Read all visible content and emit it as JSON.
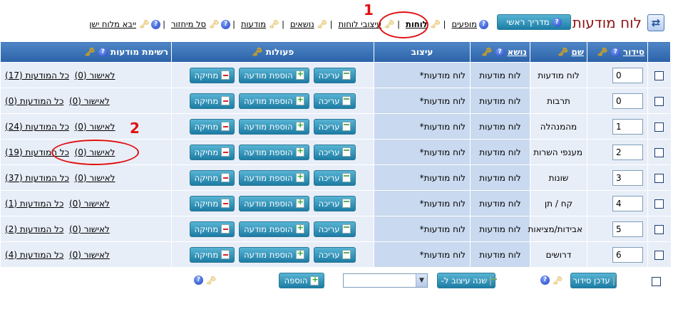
{
  "title": "לוח מודעות",
  "guide_button": "מדריך ראשי",
  "nav": {
    "items": [
      "מופעים",
      "לוחות",
      "עיצובי לוחות",
      "נושאים",
      "מודעות",
      "סל מיחזור",
      "ייבא מלוח ישן"
    ],
    "active": "לוחות"
  },
  "table": {
    "headers": {
      "order": "סידור",
      "name": "שם",
      "topic": "נושא",
      "design": "עיצוב",
      "actions": "פעולות",
      "lists": "רשימת מודעות"
    },
    "rows": [
      {
        "order": "0",
        "name": "לוח מודעות",
        "topic": "לוח מודעות",
        "design": "לוח מודעות*",
        "all": "כל המודעות (17)",
        "approve": "לאישור (0)"
      },
      {
        "order": "0",
        "name": "תרבות",
        "topic": "לוח מודעות",
        "design": "לוח מודעות*",
        "all": "כל המודעות (0)",
        "approve": "לאישור (0)"
      },
      {
        "order": "1",
        "name": "מהמנהלה",
        "topic": "לוח מודעות",
        "design": "לוח מודעות*",
        "all": "כל המודעות (24)",
        "approve": "לאישור (0)"
      },
      {
        "order": "2",
        "name": "מענפי השרות",
        "topic": "לוח מודעות",
        "design": "לוח מודעות*",
        "all": "כל המודעות (19)",
        "approve": "לאישור (0)"
      },
      {
        "order": "3",
        "name": "שונות",
        "topic": "לוח מודעות",
        "design": "לוח מודעות*",
        "all": "כל המודעות (37)",
        "approve": "לאישור (0)"
      },
      {
        "order": "4",
        "name": "קח / תן",
        "topic": "לוח מודעות",
        "design": "לוח מודעות*",
        "all": "כל המודעות (1)",
        "approve": "לאישור (0)"
      },
      {
        "order": "5",
        "name": "אבידות/מציאות",
        "topic": "לוח מודעות",
        "design": "לוח מודעות*",
        "all": "כל המודעות (2)",
        "approve": "לאישור (0)"
      },
      {
        "order": "6",
        "name": "דרושים",
        "topic": "לוח מודעות",
        "design": "לוח מודעות*",
        "all": "כל המודעות (4)",
        "approve": "לאישור (0)"
      }
    ],
    "actions": {
      "edit": "עריכה",
      "add": "הוספת מודעה",
      "delete": "מחיקה"
    }
  },
  "bottom": {
    "update_order": "עדכן סידור",
    "change_design": "שנה עיצוב ל-",
    "add": "הוספה",
    "design_select": ""
  },
  "annotations": [
    "1",
    "2"
  ],
  "colors": {
    "header": "#3b73b8",
    "title": "#8f1414",
    "button": "#2a8ab2",
    "annotation": "#e01010"
  }
}
